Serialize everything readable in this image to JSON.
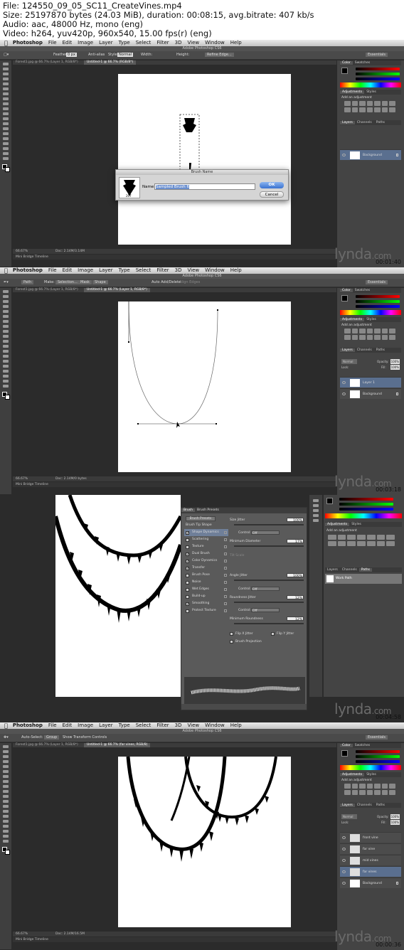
{
  "header": {
    "file": "File: 124550_09_05_SC11_CreateVines.mp4",
    "size": "Size: 25197870 bytes (24.03 MiB), duration: 00:08:15, avg.bitrate: 407 kb/s",
    "audio": "Audio: aac, 48000 Hz, mono (eng)",
    "video": "Video: h264, yuv420p, 960x540, 15.00 fps(r) (eng)"
  },
  "menu": [
    "Photoshop",
    "File",
    "Edit",
    "Image",
    "Layer",
    "Type",
    "Select",
    "Filter",
    "3D",
    "View",
    "Window",
    "Help"
  ],
  "app_title": "Adobe Photoshop CS6",
  "watermark": "lynda",
  "watermark_suffix": ".com",
  "workspace": "Essentials",
  "frames": [
    {
      "timestamp": "00:01:40",
      "tab1": "Forest1.jpg @ 66.7% (Layer 1, RGB/8*)",
      "tab2": "Untitled-1 @ 66.7% (RGB/8*)",
      "options": [
        "Feather:",
        "0 px",
        "Anti-alias",
        "Style:",
        "Normal",
        "Width:",
        "Height:",
        "Refine Edge..."
      ],
      "status_zoom": "66.67%",
      "status_doc": "Doc: 2.14M/3.14M",
      "status_tabs": "Mini Bridge   Timeline",
      "dialog": {
        "title": "Brush Name",
        "label": "Name:",
        "value": "Sampled Brush 6",
        "ok": "OK",
        "cancel": "Cancel",
        "size": "207"
      },
      "panels": {
        "color_tabs": [
          "Color",
          "Swatches"
        ],
        "adj_tabs": [
          "Adjustments",
          "Styles"
        ],
        "adj_title": "Add an adjustment",
        "layers_tabs": [
          "Layers",
          "Channels",
          "Paths"
        ],
        "layers": [
          {
            "name": "Background",
            "selected": true
          }
        ]
      }
    },
    {
      "timestamp": "00:03:18",
      "tab1": "Forest1.jpg @ 66.7% (Layer 1, RGB/8*)",
      "tab2": "Untitled-1 @ 66.7% (Layer 1, RGB/8*)",
      "options": [
        "Path",
        "Make:",
        "Selection...",
        "Mask",
        "Shape",
        "Auto Add/Delete",
        "Align Edges"
      ],
      "status_zoom": "66.67%",
      "status_doc": "Doc: 2.14M/0 bytes",
      "status_tabs": "Mini Bridge   Timeline",
      "panels": {
        "blend": "Normal",
        "opacity_label": "Opacity:",
        "opacity": "100%",
        "lock_label": "Lock:",
        "fill_label": "Fill:",
        "fill": "100%",
        "layers": [
          {
            "name": "Layer 1",
            "selected": true
          },
          {
            "name": "Background",
            "selected": false
          }
        ]
      }
    },
    {
      "timestamp": "00:04:58",
      "brush_tabs": [
        "Brush",
        "Brush Presets"
      ],
      "presets_btn": "Brush Presets",
      "tip_shape": "Brush Tip Shape",
      "options": [
        {
          "label": "Shape Dynamics",
          "checked": true,
          "hl": true
        },
        {
          "label": "Scattering",
          "checked": false
        },
        {
          "label": "Texture",
          "checked": false
        },
        {
          "label": "Dual Brush",
          "checked": true
        },
        {
          "label": "Color Dynamics",
          "checked": true
        },
        {
          "label": "Transfer",
          "checked": true
        },
        {
          "label": "Brush Pose",
          "checked": false
        },
        {
          "label": "Noise",
          "checked": false
        },
        {
          "label": "Wet Edges",
          "checked": false
        },
        {
          "label": "Build-up",
          "checked": false
        },
        {
          "label": "Smoothing",
          "checked": true
        },
        {
          "label": "Protect Texture",
          "checked": false
        }
      ],
      "settings": {
        "size_jitter": "Size Jitter",
        "size_jitter_v": "100%",
        "control": "Control:",
        "off": "Off",
        "min_diameter": "Minimum Diameter",
        "min_diameter_v": "17%",
        "tilt_scale": "Tilt Scale",
        "angle_jitter": "Angle Jitter",
        "angle_jitter_v": "100%",
        "roundness_jitter": "Roundness Jitter",
        "roundness_jitter_v": "12%",
        "min_roundness": "Minimum Roundness",
        "min_roundness_v": "12%",
        "flip_x": "Flip X Jitter",
        "flip_y": "Flip Y Jitter",
        "projection": "Brush Projection"
      },
      "paths_panel": {
        "tabs": [
          "Layers",
          "Channels",
          "Paths"
        ],
        "path": "Work Path"
      }
    },
    {
      "timestamp": "00:00:36",
      "tab1": "Forest1.jpg @ 66.7% (Layer 1, RGB/8*)",
      "tab2": "Untitled-1 @ 66.7% (far vines, RGB/8)",
      "options": [
        "Auto-Select:",
        "Group",
        "Show Transform Controls"
      ],
      "status_zoom": "66.67%",
      "status_doc": "Doc: 2.14M/16.5M",
      "status_tabs": "Mini Bridge   Timeline",
      "panels": {
        "blend": "Normal",
        "opacity": "100%",
        "fill": "100%",
        "layers": [
          {
            "name": "front vine",
            "selected": false
          },
          {
            "name": "far vine",
            "selected": false
          },
          {
            "name": "mid vines",
            "selected": false
          },
          {
            "name": "far vines",
            "selected": true
          },
          {
            "name": "Background",
            "selected": false
          }
        ]
      }
    }
  ],
  "colors": {
    "panel": "#444444",
    "menubar": "#d9d9d9",
    "selected_layer": "#5a6f8f",
    "ok_button": "#3a72d0"
  }
}
